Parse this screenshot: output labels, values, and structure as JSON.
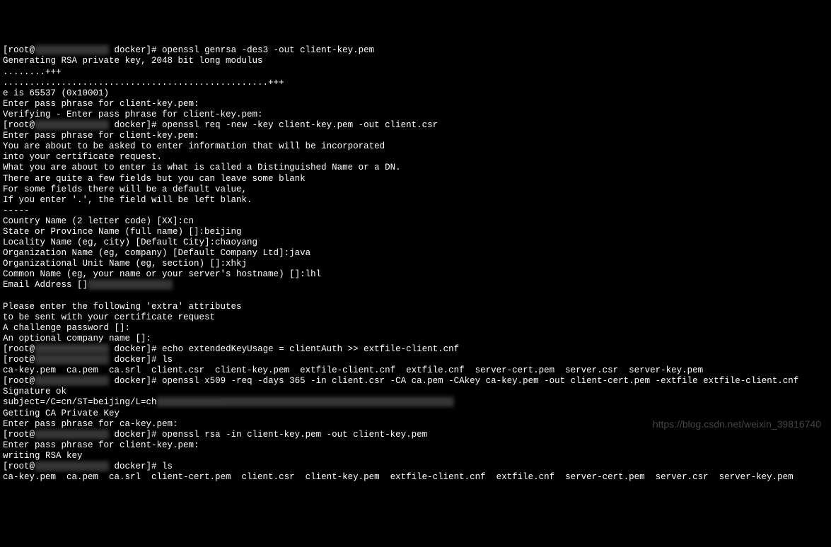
{
  "lines": [
    {
      "type": "prompt",
      "prefix": "[root@",
      "redacted": "              ",
      "suffix": " docker]# openssl genrsa -des3 -out client-key.pem"
    },
    {
      "type": "text",
      "content": "Generating RSA private key, 2048 bit long modulus"
    },
    {
      "type": "text",
      "content": "........+++"
    },
    {
      "type": "text",
      "content": "..................................................+++"
    },
    {
      "type": "text",
      "content": "e is 65537 (0x10001)"
    },
    {
      "type": "text",
      "content": "Enter pass phrase for client-key.pem:"
    },
    {
      "type": "text",
      "content": "Verifying - Enter pass phrase for client-key.pem:"
    },
    {
      "type": "prompt",
      "prefix": "[root@",
      "redacted": "              ",
      "suffix": " docker]# openssl req -new -key client-key.pem -out client.csr"
    },
    {
      "type": "text",
      "content": "Enter pass phrase for client-key.pem:"
    },
    {
      "type": "text",
      "content": "You are about to be asked to enter information that will be incorporated"
    },
    {
      "type": "text",
      "content": "into your certificate request."
    },
    {
      "type": "text",
      "content": "What you are about to enter is what is called a Distinguished Name or a DN."
    },
    {
      "type": "text",
      "content": "There are quite a few fields but you can leave some blank"
    },
    {
      "type": "text",
      "content": "For some fields there will be a default value,"
    },
    {
      "type": "text",
      "content": "If you enter '.', the field will be left blank."
    },
    {
      "type": "text",
      "content": "-----"
    },
    {
      "type": "text",
      "content": "Country Name (2 letter code) [XX]:cn"
    },
    {
      "type": "text",
      "content": "State or Province Name (full name) []:beijing"
    },
    {
      "type": "text",
      "content": "Locality Name (eg, city) [Default City]:chaoyang"
    },
    {
      "type": "text",
      "content": "Organization Name (eg, company) [Default Company Ltd]:java"
    },
    {
      "type": "text",
      "content": "Organizational Unit Name (eg, section) []:xhkj"
    },
    {
      "type": "text",
      "content": "Common Name (eg, your name or your server's hostname) []:lhl"
    },
    {
      "type": "text-redacted",
      "prefix": "Email Address []",
      "redacted": "                "
    },
    {
      "type": "text",
      "content": " "
    },
    {
      "type": "text",
      "content": "Please enter the following 'extra' attributes"
    },
    {
      "type": "text",
      "content": "to be sent with your certificate request"
    },
    {
      "type": "text",
      "content": "A challenge password []:"
    },
    {
      "type": "text",
      "content": "An optional company name []:"
    },
    {
      "type": "prompt",
      "prefix": "[root@",
      "redacted": "              ",
      "suffix": " docker]# echo extendedKeyUsage = clientAuth >> extfile-client.cnf"
    },
    {
      "type": "prompt",
      "prefix": "[root@",
      "redacted": "              ",
      "suffix": " docker]# ls"
    },
    {
      "type": "text",
      "content": "ca-key.pem  ca.pem  ca.srl  client.csr  client-key.pem  extfile-client.cnf  extfile.cnf  server-cert.pem  server.csr  server-key.pem"
    },
    {
      "type": "prompt",
      "prefix": "[root@",
      "redacted": "              ",
      "suffix": " docker]# openssl x509 -req -days 365 -in client.csr -CA ca.pem -CAkey ca-key.pem -out client-cert.pem -extfile extfile-client.cnf"
    },
    {
      "type": "text",
      "content": "Signature ok"
    },
    {
      "type": "text-redacted",
      "prefix": "subject=/C=cn/ST=beijing/L=ch",
      "redacted": "                                                        "
    },
    {
      "type": "text",
      "content": "Getting CA Private Key"
    },
    {
      "type": "text",
      "content": "Enter pass phrase for ca-key.pem:"
    },
    {
      "type": "prompt",
      "prefix": "[root@",
      "redacted": "              ",
      "suffix": " docker]# openssl rsa -in client-key.pem -out client-key.pem"
    },
    {
      "type": "text",
      "content": "Enter pass phrase for client-key.pem:"
    },
    {
      "type": "text",
      "content": "writing RSA key"
    },
    {
      "type": "prompt",
      "prefix": "[root@",
      "redacted": "              ",
      "suffix": " docker]# ls"
    },
    {
      "type": "text",
      "content": "ca-key.pem  ca.pem  ca.srl  client-cert.pem  client.csr  client-key.pem  extfile-client.cnf  extfile.cnf  server-cert.pem  server.csr  server-key.pem"
    }
  ],
  "watermark": "https://blog.csdn.net/weixin_39816740"
}
